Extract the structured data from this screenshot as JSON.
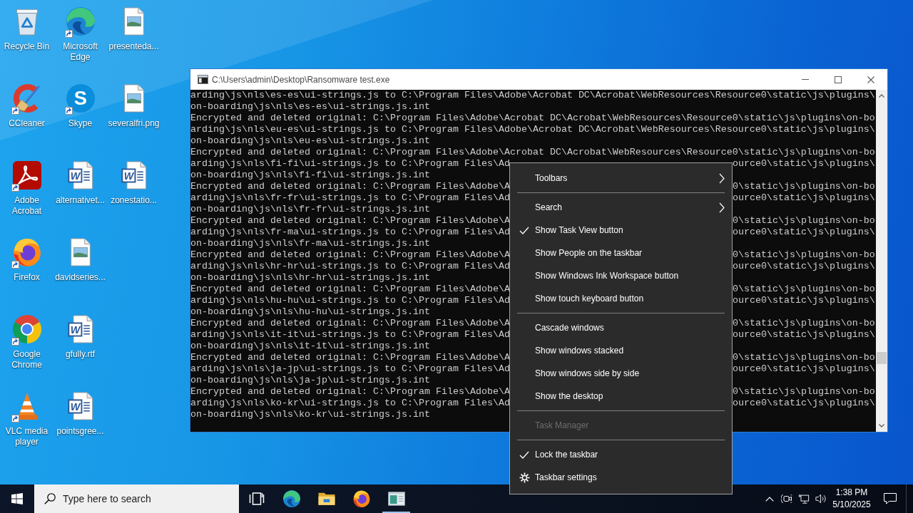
{
  "desktop": {
    "columns": [
      {
        "icons": [
          {
            "label": "Recycle Bin",
            "kind": "recycle-bin",
            "shortcut": false
          },
          {
            "label": "CCleaner",
            "kind": "ccleaner",
            "shortcut": true
          },
          {
            "label": "Adobe Acrobat",
            "kind": "acrobat",
            "shortcut": true
          },
          {
            "label": "Firefox",
            "kind": "firefox",
            "shortcut": true
          },
          {
            "label": "Google Chrome",
            "kind": "chrome",
            "shortcut": true
          },
          {
            "label": "VLC media player",
            "kind": "vlc",
            "shortcut": true
          }
        ]
      },
      {
        "icons": [
          {
            "label": "Microsoft Edge",
            "kind": "edge",
            "shortcut": true
          },
          {
            "label": "Skype",
            "kind": "skype",
            "shortcut": true,
            "icon_letter": "S"
          },
          {
            "label": "alternativet...",
            "kind": "word-file",
            "shortcut": false,
            "icon_letter": "W"
          },
          {
            "label": "davidseries...",
            "kind": "image-file",
            "shortcut": false
          },
          {
            "label": "gfully.rtf",
            "kind": "word-file",
            "shortcut": false,
            "icon_letter": "W"
          },
          {
            "label": "pointsgree...",
            "kind": "word-file",
            "shortcut": false,
            "icon_letter": "W"
          }
        ]
      },
      {
        "icons": [
          {
            "label": "presenteda...",
            "kind": "image-file",
            "shortcut": false
          },
          {
            "label": "severalfri.png",
            "kind": "image-file",
            "shortcut": false
          },
          {
            "label": "zonestatio...",
            "kind": "word-file",
            "shortcut": false,
            "icon_letter": "W"
          }
        ]
      }
    ]
  },
  "console_window": {
    "title": "C:\\Users\\admin\\Desktop\\Ransomware test.exe",
    "lines": [
      {
        "kind": "whole",
        "text": "arding\\js\\nls\\es-es\\ui-strings.js to C:\\Program Files\\Adobe\\Acrobat DC\\Acrobat\\WebResources\\Resource0\\static\\js\\plugins\\"
      },
      {
        "kind": "whole",
        "text": "on-boarding\\js\\nls\\es-es\\ui-strings.js.int"
      },
      {
        "kind": "whole",
        "text": "Encrypted and deleted original: C:\\Program Files\\Adobe\\Acrobat DC\\Acrobat\\WebResources\\Resource0\\static\\js\\plugins\\on-bo"
      },
      {
        "kind": "whole",
        "text": "arding\\js\\nls\\eu-es\\ui-strings.js to C:\\Program Files\\Adobe\\Acrobat DC\\Acrobat\\WebResources\\Resource0\\static\\js\\plugins\\"
      },
      {
        "kind": "whole",
        "text": "on-boarding\\js\\nls\\eu-es\\ui-strings.js.int"
      },
      {
        "kind": "whole",
        "text": "Encrypted and deleted original: C:\\Program Files\\Adobe\\Acrobat DC\\Acrobat\\WebResources\\Resource0\\static\\js\\plugins\\on-bo"
      },
      {
        "kind": "split",
        "segments": [
          "arding\\js\\nls\\fi-fi\\ui-strings.js to C:\\Program Files\\Ad",
          "ource0\\static\\js\\plugins\\"
        ]
      },
      {
        "kind": "whole",
        "text": "on-boarding\\js\\nls\\fi-fi\\ui-strings.js.int"
      },
      {
        "kind": "split",
        "segments": [
          "Encrypted and deleted original: C:\\Program Files\\Adobe\\A",
          "0\\static\\js\\plugins\\on-bo"
        ]
      },
      {
        "kind": "split",
        "segments": [
          "arding\\js\\nls\\fr-fr\\ui-strings.js to C:\\Program Files\\Ad",
          "ource0\\static\\js\\plugins\\"
        ]
      },
      {
        "kind": "whole",
        "text": "on-boarding\\js\\nls\\fr-fr\\ui-strings.js.int"
      },
      {
        "kind": "split",
        "segments": [
          "Encrypted and deleted original: C:\\Program Files\\Adobe\\A",
          "0\\static\\js\\plugins\\on-bo"
        ]
      },
      {
        "kind": "split",
        "segments": [
          "arding\\js\\nls\\fr-ma\\ui-strings.js to C:\\Program Files\\Ad",
          "ource0\\static\\js\\plugins\\"
        ]
      },
      {
        "kind": "whole",
        "text": "on-boarding\\js\\nls\\fr-ma\\ui-strings.js.int"
      },
      {
        "kind": "split",
        "segments": [
          "Encrypted and deleted original: C:\\Program Files\\Adobe\\A",
          "0\\static\\js\\plugins\\on-bo"
        ]
      },
      {
        "kind": "split",
        "segments": [
          "arding\\js\\nls\\hr-hr\\ui-strings.js to C:\\Program Files\\Ad",
          "ource0\\static\\js\\plugins\\"
        ]
      },
      {
        "kind": "whole",
        "text": "on-boarding\\js\\nls\\hr-hr\\ui-strings.js.int"
      },
      {
        "kind": "split",
        "segments": [
          "Encrypted and deleted original: C:\\Program Files\\Adobe\\A",
          "0\\static\\js\\plugins\\on-bo"
        ]
      },
      {
        "kind": "split",
        "segments": [
          "arding\\js\\nls\\hu-hu\\ui-strings.js to C:\\Program Files\\Ad",
          "ource0\\static\\js\\plugins\\"
        ]
      },
      {
        "kind": "whole",
        "text": "on-boarding\\js\\nls\\hu-hu\\ui-strings.js.int"
      },
      {
        "kind": "split",
        "segments": [
          "Encrypted and deleted original: C:\\Program Files\\Adobe\\A",
          "0\\static\\js\\plugins\\on-bo"
        ]
      },
      {
        "kind": "split",
        "segments": [
          "arding\\js\\nls\\it-it\\ui-strings.js to C:\\Program Files\\Ad",
          "ource0\\static\\js\\plugins\\"
        ]
      },
      {
        "kind": "whole",
        "text": "on-boarding\\js\\nls\\it-it\\ui-strings.js.int"
      },
      {
        "kind": "split",
        "segments": [
          "Encrypted and deleted original: C:\\Program Files\\Adobe\\A",
          "0\\static\\js\\plugins\\on-bo"
        ]
      },
      {
        "kind": "split",
        "segments": [
          "arding\\js\\nls\\ja-jp\\ui-strings.js to C:\\Program Files\\Ad",
          "ource0\\static\\js\\plugins\\"
        ]
      },
      {
        "kind": "whole",
        "text": "on-boarding\\js\\nls\\ja-jp\\ui-strings.js.int"
      },
      {
        "kind": "split",
        "segments": [
          "Encrypted and deleted original: C:\\Program Files\\Adobe\\A",
          "0\\static\\js\\plugins\\on-bo"
        ]
      },
      {
        "kind": "split",
        "segments": [
          "arding\\js\\nls\\ko-kr\\ui-strings.js to C:\\Program Files\\Ad",
          "ource0\\static\\js\\plugins\\"
        ]
      },
      {
        "kind": "whole",
        "text": "on-boarding\\js\\nls\\ko-kr\\ui-strings.js.int"
      }
    ]
  },
  "context_menu": {
    "groups": [
      {
        "items": [
          {
            "label": "Toolbars",
            "kind": "submenu",
            "checked": false,
            "disabled": false
          }
        ]
      },
      {
        "items": [
          {
            "label": "Search",
            "kind": "submenu",
            "checked": false,
            "disabled": false
          },
          {
            "label": "Show Task View button",
            "kind": "command",
            "checked": true,
            "disabled": false
          },
          {
            "label": "Show People on the taskbar",
            "kind": "command",
            "checked": false,
            "disabled": false
          },
          {
            "label": "Show Windows Ink Workspace button",
            "kind": "command",
            "checked": false,
            "disabled": false
          },
          {
            "label": "Show touch keyboard button",
            "kind": "command",
            "checked": false,
            "disabled": false
          }
        ]
      },
      {
        "items": [
          {
            "label": "Cascade windows",
            "kind": "command",
            "checked": false,
            "disabled": false
          },
          {
            "label": "Show windows stacked",
            "kind": "command",
            "checked": false,
            "disabled": false
          },
          {
            "label": "Show windows side by side",
            "kind": "command",
            "checked": false,
            "disabled": false
          },
          {
            "label": "Show the desktop",
            "kind": "command",
            "checked": false,
            "disabled": false
          }
        ]
      },
      {
        "items": [
          {
            "label": "Task Manager",
            "kind": "command",
            "checked": false,
            "disabled": true
          }
        ]
      },
      {
        "items": [
          {
            "label": "Lock the taskbar",
            "kind": "command",
            "checked": true,
            "disabled": false
          },
          {
            "label": "Taskbar settings",
            "kind": "settings",
            "checked": false,
            "disabled": false
          }
        ]
      }
    ]
  },
  "taskbar": {
    "search": {
      "placeholder": "Type here to search"
    },
    "apps": [
      {
        "kind": "task-view",
        "running": false
      },
      {
        "kind": "edge",
        "running": false
      },
      {
        "kind": "folder",
        "running": false
      },
      {
        "kind": "firefox",
        "running": false
      },
      {
        "kind": "console",
        "running": true
      }
    ],
    "clock": {
      "time": "1:38 PM",
      "date": "5/10/2025"
    }
  }
}
